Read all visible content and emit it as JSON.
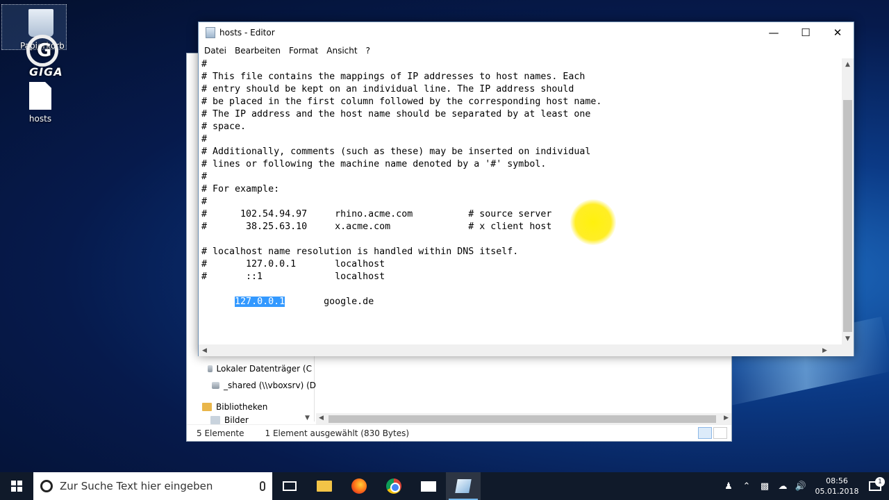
{
  "desktop": {
    "recycle_label": "Papierkorb",
    "giga_label": "GIGA",
    "hosts_icon_label": "hosts"
  },
  "explorer": {
    "nav_items": [
      {
        "label": "Lokaler Datenträger (C",
        "icon": "drive-icon"
      },
      {
        "label": "_shared (\\\\vboxsrv) (D",
        "icon": "network-drive-icon"
      },
      {
        "label": "Bibliotheken",
        "icon": "library-icon"
      },
      {
        "label": "Bilder",
        "icon": "pictures-icon"
      }
    ],
    "status_count": "5 Elemente",
    "status_selected": "1 Element ausgewählt (830 Bytes)"
  },
  "notepad": {
    "title": "hosts - Editor",
    "menu": [
      "Datei",
      "Bearbeiten",
      "Format",
      "Ansicht",
      "?"
    ],
    "lines": [
      "#",
      "# This file contains the mappings of IP addresses to host names. Each",
      "# entry should be kept on an individual line. The IP address should",
      "# be placed in the first column followed by the corresponding host name.",
      "# The IP address and the host name should be separated by at least one",
      "# space.",
      "#",
      "# Additionally, comments (such as these) may be inserted on individual",
      "# lines or following the machine name denoted by a '#' symbol.",
      "#",
      "# For example:",
      "#",
      "#      102.54.94.97     rhino.acme.com          # source server",
      "#       38.25.63.10     x.acme.com              # x client host",
      "",
      "# localhost name resolution is handled within DNS itself.",
      "#       127.0.0.1       localhost",
      "#       ::1             localhost",
      ""
    ],
    "last_line_indent": "      ",
    "selected_text": "127.0.0.1",
    "last_line_rest": "       google.de"
  },
  "taskbar": {
    "search_placeholder": "Zur Suche Text hier eingeben",
    "time": "08:56",
    "date": "05.01.2018",
    "notification_count": "1"
  },
  "colors": {
    "selection": "#3399ff",
    "cursor_highlight": "#ffeb00",
    "taskbar": "#101a2a"
  }
}
